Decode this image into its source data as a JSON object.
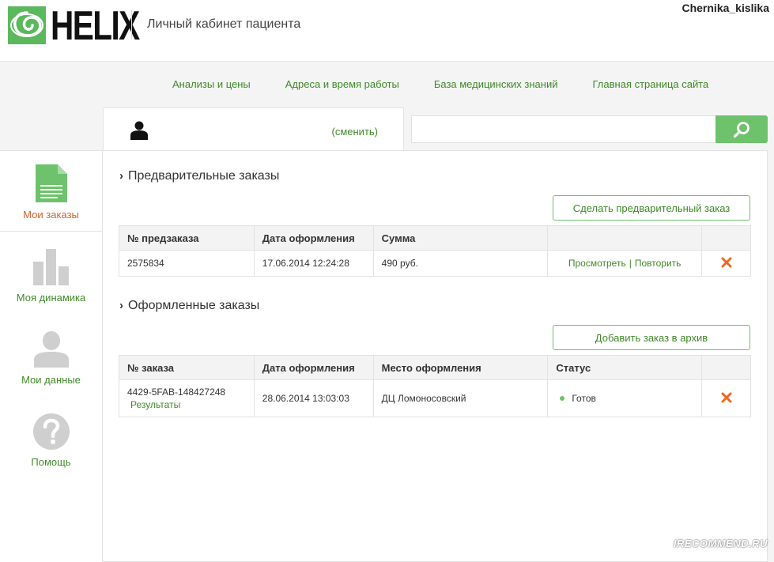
{
  "header": {
    "logo_text": "HELIX",
    "title": "Личный кабинет пациента",
    "username": "Chernika_kislika"
  },
  "nav": [
    {
      "label": "Анализы и цены"
    },
    {
      "label": "Адреса и время работы"
    },
    {
      "label": "База медицинских знаний"
    },
    {
      "label": "Главная страница сайта"
    }
  ],
  "user_tab": {
    "change_label": "(сменить)"
  },
  "search": {
    "value": "",
    "placeholder": ""
  },
  "sidebar": {
    "items": [
      {
        "label": "Мои заказы",
        "icon": "document-icon",
        "active": true
      },
      {
        "label": "Моя динамика",
        "icon": "bar-chart-icon",
        "active": false
      },
      {
        "label": "Мои данные",
        "icon": "person-icon",
        "active": false
      },
      {
        "label": "Помощь",
        "icon": "question-icon",
        "active": false
      }
    ]
  },
  "preorders": {
    "title": "Предварительные заказы",
    "button_label": "Сделать предварительный заказ",
    "columns": [
      "№ предзаказа",
      "Дата оформления",
      "Сумма",
      "",
      ""
    ],
    "rows": [
      {
        "number": "2575834",
        "date": "17.06.2014 12:24:28",
        "sum": "490 руб.",
        "view_label": "Просмотреть",
        "separator": "|",
        "repeat_label": "Повторить"
      }
    ]
  },
  "orders": {
    "title": "Оформленные заказы",
    "button_label": "Добавить заказ в архив",
    "columns": [
      "№ заказа",
      "Дата оформления",
      "Место оформления",
      "Статус",
      ""
    ],
    "rows": [
      {
        "number": "4429-5FAB-148427248",
        "results_label": "Результаты",
        "date": "28.06.2014 13:03:03",
        "place": "ДЦ Ломоносовский",
        "status": "Готов"
      }
    ]
  },
  "watermark": "IRECOMMEND.RU",
  "colors": {
    "accent_green": "#3f8a28",
    "button_green": "#6dc26b",
    "active_orange": "#d4622a",
    "delete_orange": "#e86a24"
  }
}
